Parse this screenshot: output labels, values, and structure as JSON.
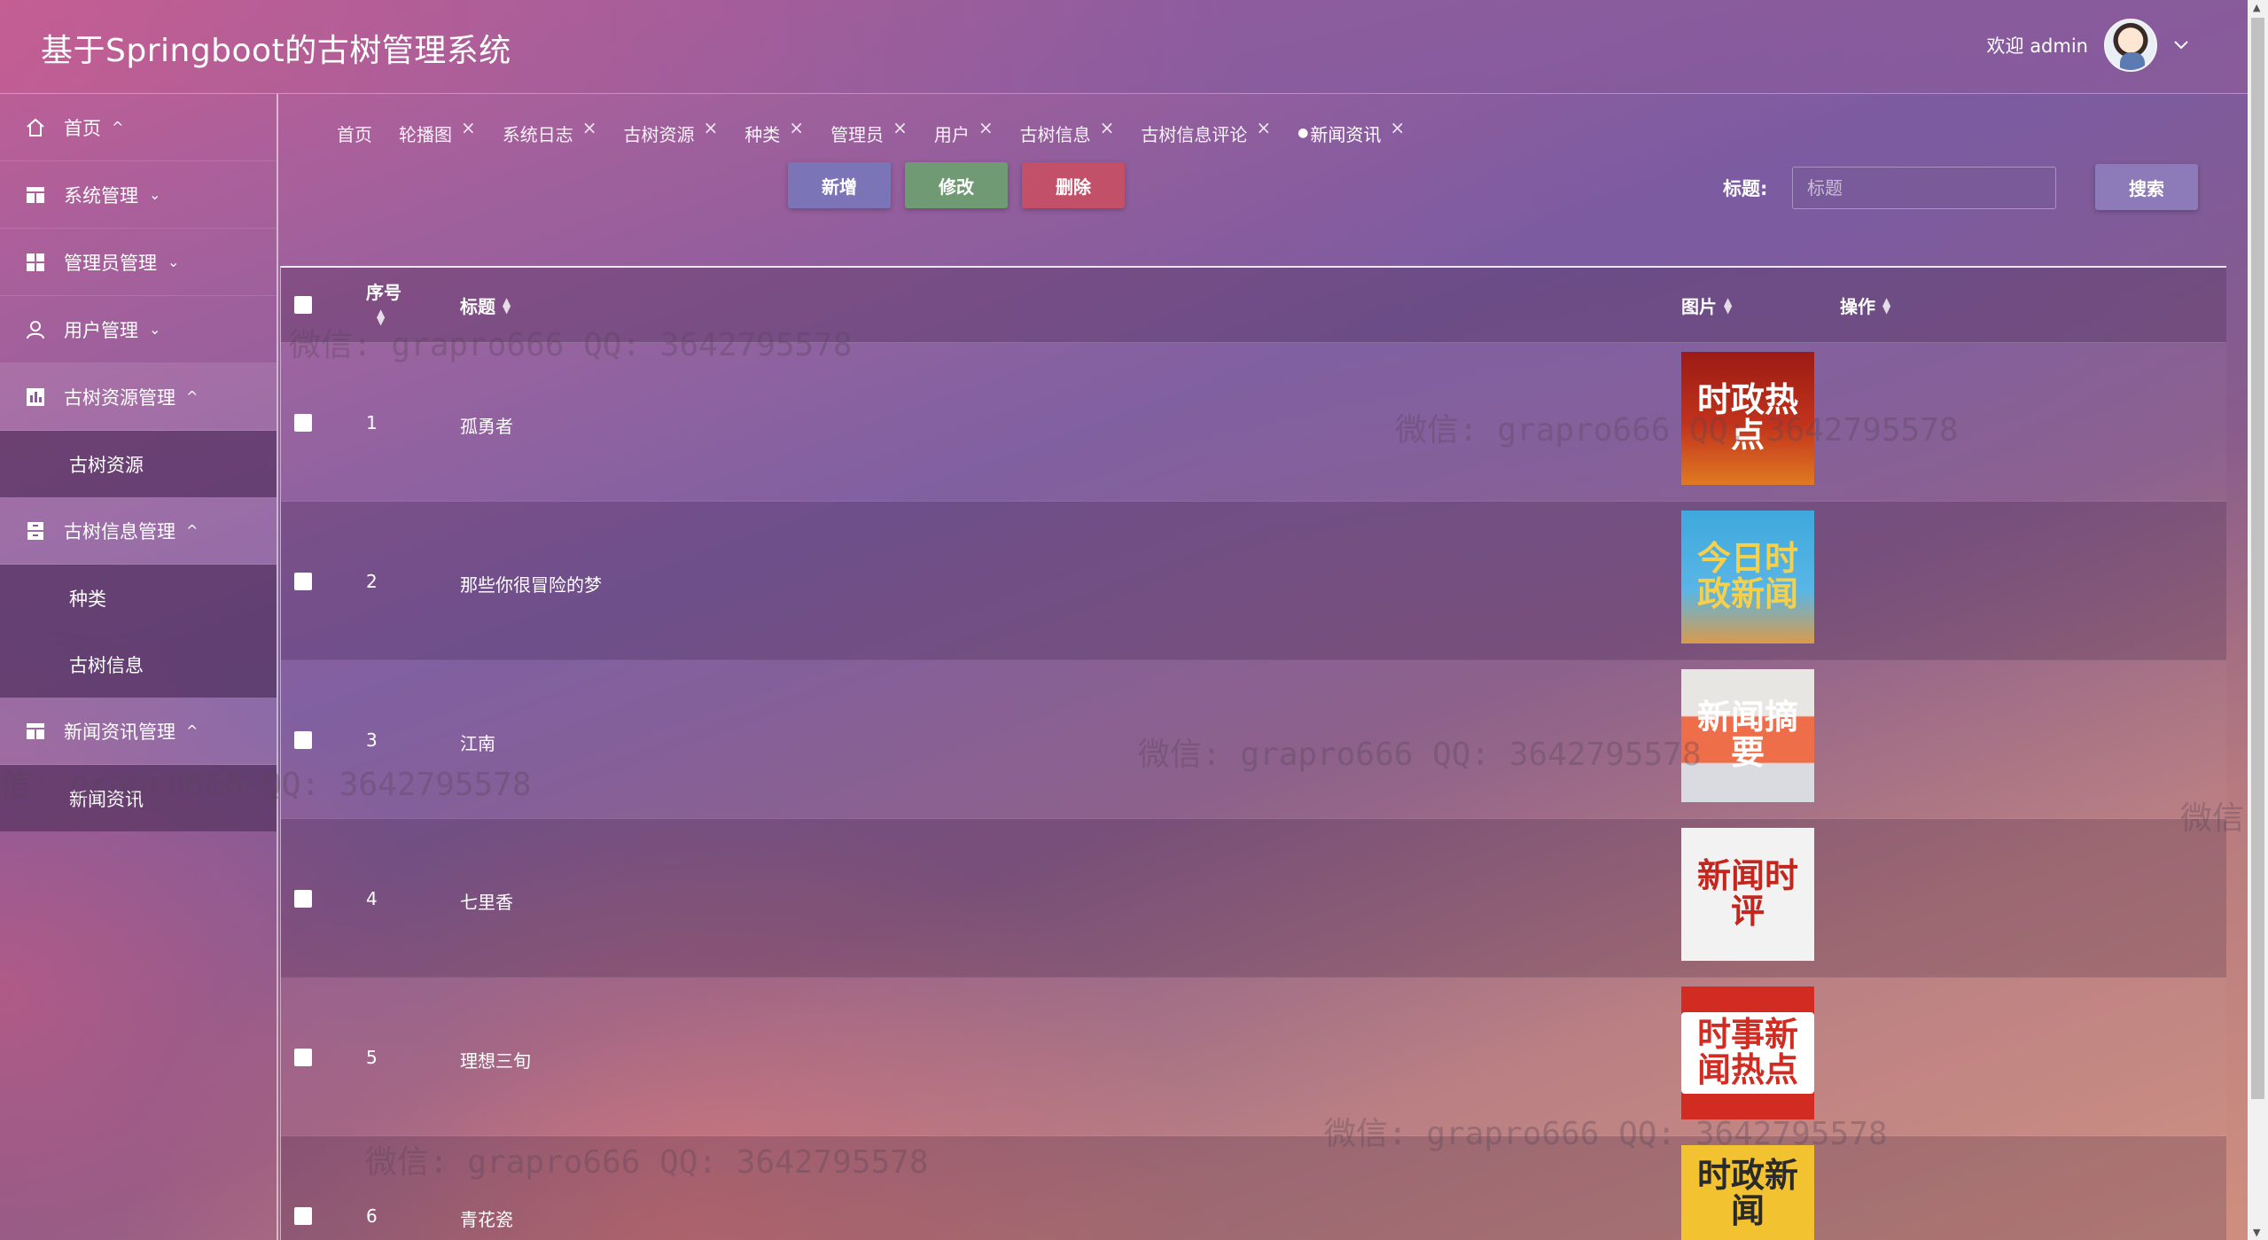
{
  "app": {
    "title": "基于Springboot的古树管理系统",
    "welcome": "欢迎 admin"
  },
  "sidebar": {
    "items": [
      {
        "label": "首页",
        "icon": "home-icon",
        "caret": "^"
      },
      {
        "label": "系统管理",
        "icon": "table-icon",
        "caret": "v"
      },
      {
        "label": "管理员管理",
        "icon": "grid-icon",
        "caret": "v"
      },
      {
        "label": "用户管理",
        "icon": "user-icon",
        "caret": "v"
      },
      {
        "label": "古树资源管理",
        "icon": "chart-icon",
        "caret": "^",
        "sub": [
          "古树资源"
        ]
      },
      {
        "label": "古树信息管理",
        "icon": "archive-icon",
        "caret": "^",
        "sub": [
          "种类",
          "古树信息"
        ]
      },
      {
        "label": "新闻资讯管理",
        "icon": "table-icon",
        "caret": "^",
        "sub": [
          "新闻资讯"
        ]
      }
    ]
  },
  "tabs": [
    {
      "label": "首页",
      "closable": false
    },
    {
      "label": "轮播图",
      "closable": true
    },
    {
      "label": "系统日志",
      "closable": true
    },
    {
      "label": "古树资源",
      "closable": true
    },
    {
      "label": "种类",
      "closable": true
    },
    {
      "label": "管理员",
      "closable": true
    },
    {
      "label": "用户",
      "closable": true
    },
    {
      "label": "古树信息",
      "closable": true
    },
    {
      "label": "古树信息评论",
      "closable": true
    },
    {
      "label": "新闻资讯",
      "closable": true,
      "active": true
    }
  ],
  "toolbar": {
    "add_label": "新增",
    "edit_label": "修改",
    "delete_label": "删除",
    "search_label": "标题:",
    "search_placeholder": "标题",
    "search_button": "搜索"
  },
  "table": {
    "columns": [
      "序号",
      "标题",
      "图片",
      "操作"
    ],
    "rows": [
      {
        "index": "1",
        "title": "孤勇者",
        "image_text": "时政热点"
      },
      {
        "index": "2",
        "title": "那些你很冒险的梦",
        "image_text": "今日时政新闻"
      },
      {
        "index": "3",
        "title": "江南",
        "image_text": "新闻摘要"
      },
      {
        "index": "4",
        "title": "七里香",
        "image_text": "新闻时评"
      },
      {
        "index": "5",
        "title": "理想三旬",
        "image_text": "时事新闻热点"
      },
      {
        "index": "6",
        "title": "青花瓷",
        "image_text": "时政新闻"
      }
    ]
  },
  "watermarks": [
    "微信: grapro666 QQ: 3642795578",
    "微信: grapro666 QQ: 3642795578",
    "微信: grapro666 QQ: 3642795578",
    "信: grapro666 QQ: 3642795578",
    "微信: grapro666 QQ: 3642795578",
    "微信: grapro666 QQ: 3642795578",
    "微信:"
  ]
}
